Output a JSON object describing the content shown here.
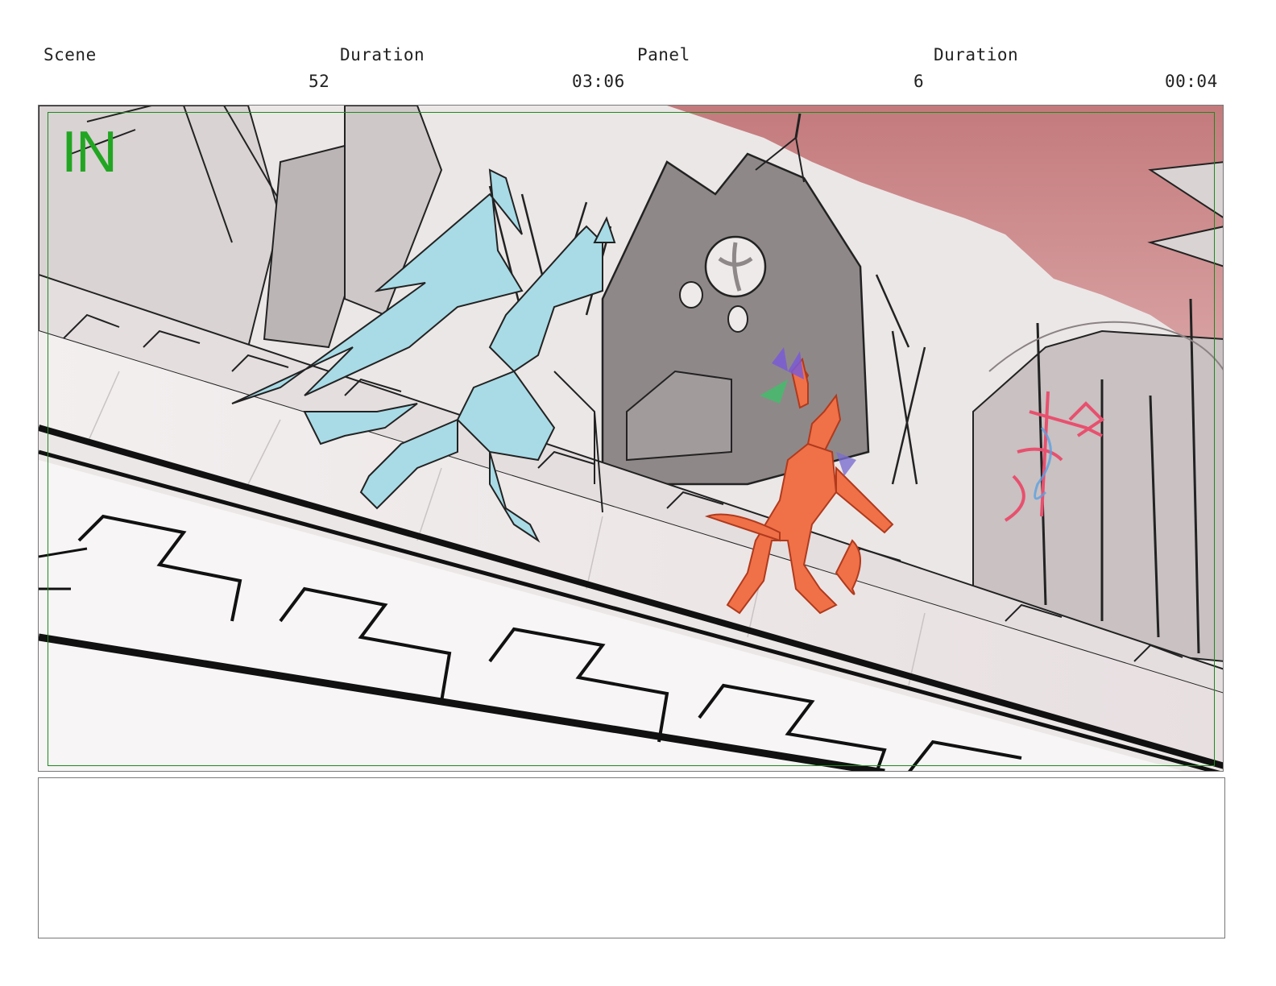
{
  "header": {
    "scene_label": "Scene",
    "scene_duration_label": "Duration",
    "panel_label": "Panel",
    "panel_duration_label": "Duration",
    "scene_number": "52",
    "scene_duration": "03:06",
    "panel_number": "6",
    "panel_duration": "00:04"
  },
  "panel": {
    "transition_tag": "IN",
    "safe_frame_color": "#1c8a1c",
    "sky_color": "#c47a7c",
    "character_left_color": "#a8dbe6",
    "character_right_color": "#f07048",
    "sword_marker_color": "#e8506e"
  },
  "notes": {
    "text": ""
  }
}
